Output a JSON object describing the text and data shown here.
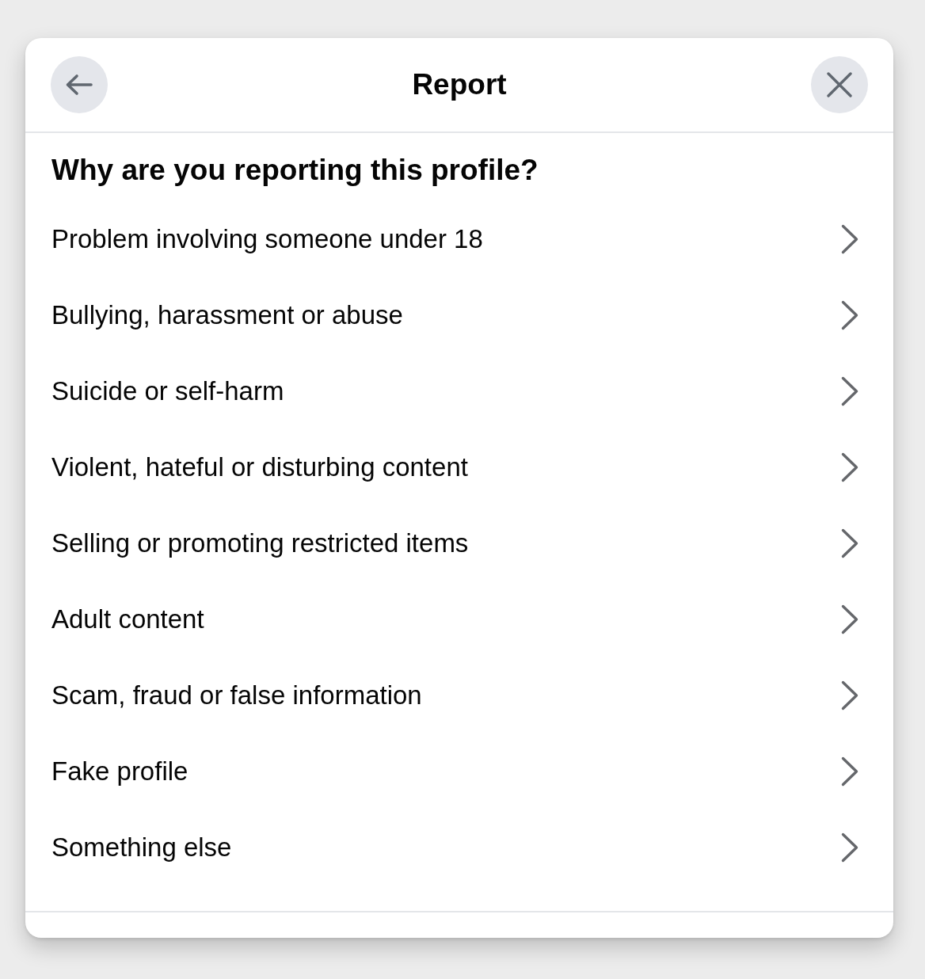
{
  "dialog": {
    "title": "Report"
  },
  "question": "Why are you reporting this profile?",
  "options": [
    {
      "label": "Problem involving someone under 18"
    },
    {
      "label": "Bullying, harassment or abuse"
    },
    {
      "label": "Suicide or self-harm"
    },
    {
      "label": "Violent, hateful or disturbing content"
    },
    {
      "label": "Selling or promoting restricted items"
    },
    {
      "label": "Adult content"
    },
    {
      "label": "Scam, fraud or false information"
    },
    {
      "label": "Fake profile"
    },
    {
      "label": "Something else"
    }
  ]
}
